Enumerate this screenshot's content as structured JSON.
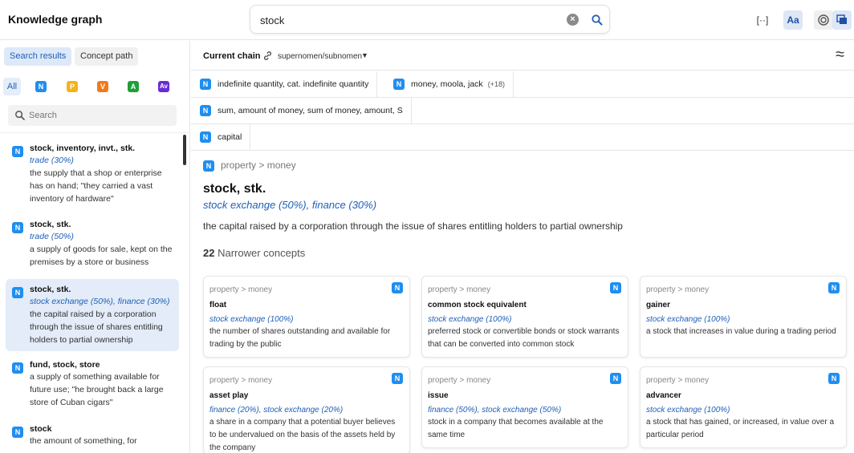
{
  "header": {
    "title": "Knowledge graph",
    "search_value": "stock",
    "icons": [
      "bracket-icon",
      "font-size-icon",
      "target-icon",
      "layers-icon"
    ],
    "font_label": "Aa",
    "bracket_label": "[··]"
  },
  "sidebar": {
    "tabs": [
      {
        "label": "Search results",
        "active": true
      },
      {
        "label": "Concept path",
        "active": false
      }
    ],
    "filters": {
      "all": "All",
      "n": "N",
      "p": "P",
      "v": "V",
      "a": "A",
      "av": "Av"
    },
    "search_placeholder": "Search",
    "results": [
      {
        "pos": "N",
        "title": "stock, inventory, invt., stk.",
        "category": "trade (30%)",
        "definition": "the supply that a shop or enterprise has on hand; \"they carried a vast inventory of hardware\""
      },
      {
        "pos": "N",
        "title": "stock, stk.",
        "category": "trade (50%)",
        "definition": "a supply of goods for sale, kept on the premises by a store or business"
      },
      {
        "pos": "N",
        "title": "stock, stk.",
        "category": "stock exchange (50%), finance (30%)",
        "definition": "the capital raised by a corporation through the issue of shares entitling holders to partial ownership",
        "selected": true
      },
      {
        "pos": "N",
        "title": "fund, stock, store",
        "category": "",
        "definition": "a supply of something available for future use; \"he brought back a large store of Cuban cigars\""
      },
      {
        "pos": "N",
        "title": "stock",
        "category": "",
        "definition": "the amount of something, for"
      }
    ]
  },
  "chain": {
    "label": "Current chain",
    "value": "supernomen/subnomen",
    "rows": [
      [
        {
          "pos": "N",
          "label": "indefinite quantity, cat. indefinite quantity"
        },
        {
          "pos": "N",
          "label": "money, moola, jack",
          "more": "(+18)"
        }
      ],
      [
        {
          "pos": "N",
          "label": "sum, amount of money, sum of money, amount, S"
        }
      ],
      [
        {
          "pos": "N",
          "label": "capital"
        }
      ]
    ]
  },
  "detail": {
    "pos": "N",
    "breadcrumb": "property > money",
    "title": "stock, stk.",
    "category": "stock exchange (50%), finance (30%)",
    "definition": "the capital raised by a corporation through the issue of shares entitling holders to partial ownership",
    "narrower_count": "22",
    "narrower_label": "Narrower concepts",
    "cards": [
      {
        "pos": "N",
        "breadcrumb": "property > money",
        "title": "float",
        "category": "stock exchange (100%)",
        "definition": "the number of shares outstanding and available for trading by the public"
      },
      {
        "pos": "N",
        "breadcrumb": "property > money",
        "title": "common stock equivalent",
        "category": "stock exchange (100%)",
        "definition": "preferred stock or convertible bonds or stock warrants that can be converted into common stock"
      },
      {
        "pos": "N",
        "breadcrumb": "property > money",
        "title": "gainer",
        "category": "stock exchange (100%)",
        "definition": "a stock that increases in value during a trading period"
      },
      {
        "pos": "N",
        "breadcrumb": "property > money",
        "title": "asset play",
        "category": "finance (20%), stock exchange (20%)",
        "definition": "a share in a company that a potential buyer believes to be undervalued on the basis of the assets held by the company"
      },
      {
        "pos": "N",
        "breadcrumb": "property > money",
        "title": "issue",
        "category": "finance (50%), stock exchange (50%)",
        "definition": "stock in a company that becomes available at the same time"
      },
      {
        "pos": "N",
        "breadcrumb": "property > money",
        "title": "advancer",
        "category": "stock exchange (100%)",
        "definition": "a stock that has gained, or increased, in value over a particular period"
      }
    ]
  },
  "colors": {
    "accent": "#1f5fb8",
    "noun_tag": "#1f8ef0",
    "selected_bg": "#e3ecf8"
  }
}
